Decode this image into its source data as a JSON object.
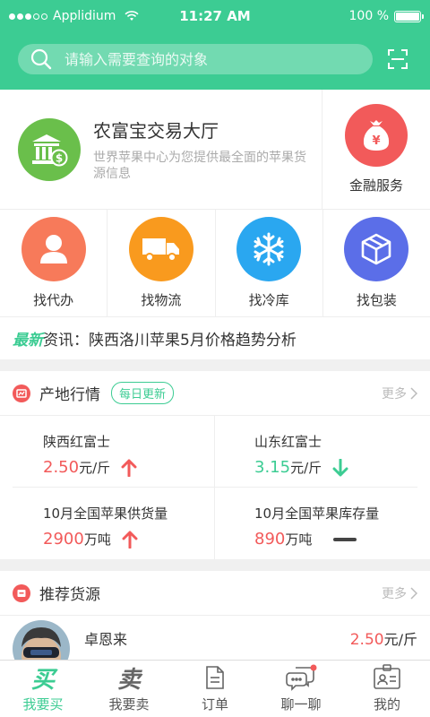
{
  "status_bar": {
    "carrier": "Applidium",
    "time": "11:27 AM",
    "battery": "100 %",
    "battery_level": 1.0
  },
  "search": {
    "placeholder": "请输入需要查询的对象"
  },
  "exchange": {
    "title": "农富宝交易大厅",
    "description": "世界苹果中心为您提供最全面的苹果货源信息"
  },
  "finance": {
    "label": "金融服务"
  },
  "services": [
    {
      "label": "找代办",
      "color": "#f77a5a",
      "icon": "person-icon"
    },
    {
      "label": "找物流",
      "color": "#f99a1e",
      "icon": "truck-icon"
    },
    {
      "label": "找冷库",
      "color": "#2aa7f0",
      "icon": "snowflake-icon"
    },
    {
      "label": "找包装",
      "color": "#5b6ee8",
      "icon": "box-icon"
    }
  ],
  "news": {
    "tag": "最新",
    "prefix": "资讯：",
    "text": "陕西洛川苹果5月价格趋势分析"
  },
  "market": {
    "title": "产地行情",
    "badge": "每日更新",
    "more": "更多",
    "items": [
      {
        "name": "陕西红富士",
        "value": "2.50",
        "unit": "元/斤",
        "trend": "up"
      },
      {
        "name": "山东红富士",
        "value": "3.15",
        "unit": "元/斤",
        "trend": "down"
      },
      {
        "name": "10月全国苹果供货量",
        "value": "2900",
        "unit": "万吨",
        "trend": "up"
      },
      {
        "name": "10月全国苹果库存量",
        "value": "890",
        "unit": "万吨",
        "trend": "flat"
      }
    ]
  },
  "recommend": {
    "title": "推荐货源",
    "more": "更多",
    "items": [
      {
        "name": "卓恩来",
        "price": "2.50",
        "unit": "元/斤"
      }
    ]
  },
  "tabbar": [
    {
      "glyph": "买",
      "label": "我要买",
      "active": true
    },
    {
      "glyph": "卖",
      "label": "我要卖",
      "active": false
    },
    {
      "glyph": "",
      "label": "订单",
      "active": false
    },
    {
      "glyph": "",
      "label": "聊一聊",
      "active": false
    },
    {
      "glyph": "",
      "label": "我的",
      "active": false
    }
  ],
  "colors": {
    "brand": "#3ccc93",
    "up": "#f25a5a",
    "down": "#3ccc93"
  }
}
